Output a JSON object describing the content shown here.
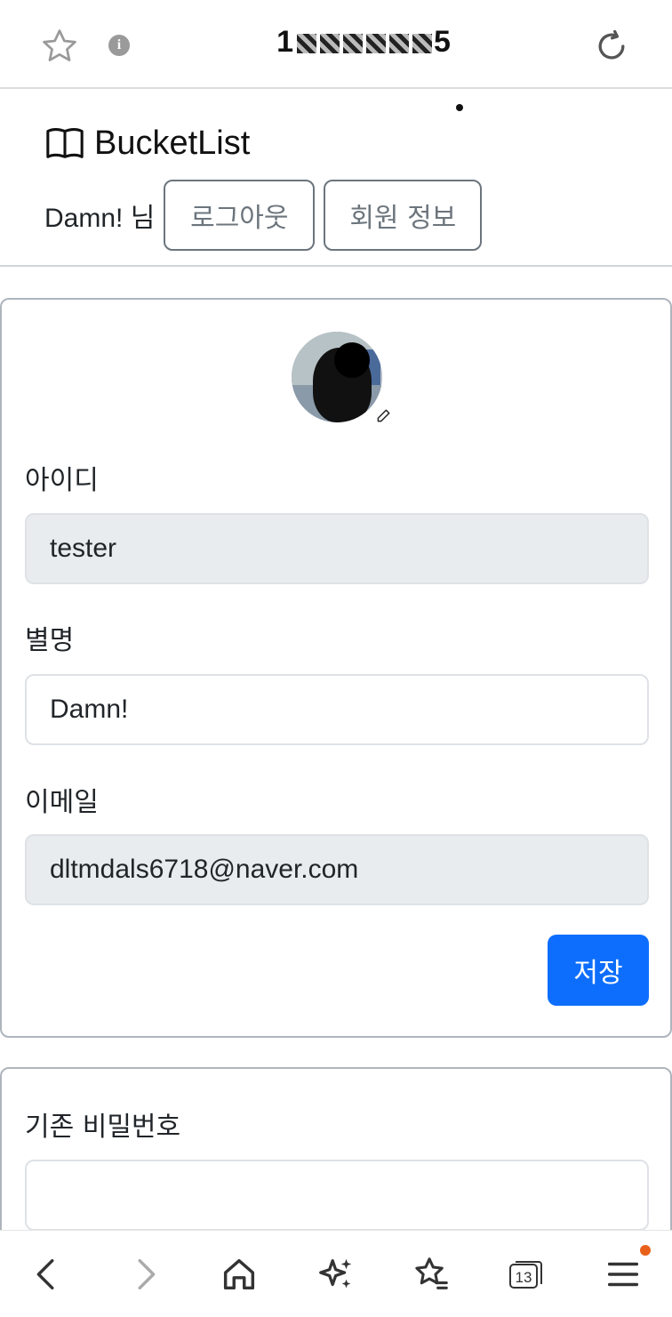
{
  "browser": {
    "url_prefix": "1",
    "url_suffix": "5",
    "icons": {
      "star": "star-outline-icon",
      "info": "info-icon",
      "reload": "reload-icon"
    }
  },
  "header": {
    "brand": "BucketList",
    "brand_icon": "book-icon",
    "user_greeting": "Damn! 님",
    "logout_label": "로그아웃",
    "member_info_label": "회원 정보"
  },
  "profile": {
    "avatar_edit_icon": "pencil-icon",
    "id_label": "아이디",
    "id_value": "tester",
    "nickname_label": "별명",
    "nickname_value": "Damn!",
    "email_label": "이메일",
    "email_value": "dltmdals6718@naver.com",
    "save_label": "저장"
  },
  "password": {
    "current_label": "기존 비밀번호",
    "current_value": ""
  },
  "bottom_nav": {
    "items": [
      "back-icon",
      "forward-icon",
      "home-icon",
      "sparkle-icon",
      "bookmarks-icon",
      "tabs-icon",
      "menu-icon"
    ],
    "tab_count": "13"
  },
  "colors": {
    "primary": "#0d6efd",
    "secondary": "#6c757d",
    "readonly_bg": "#e9ecef",
    "notification": "#e8611a"
  }
}
